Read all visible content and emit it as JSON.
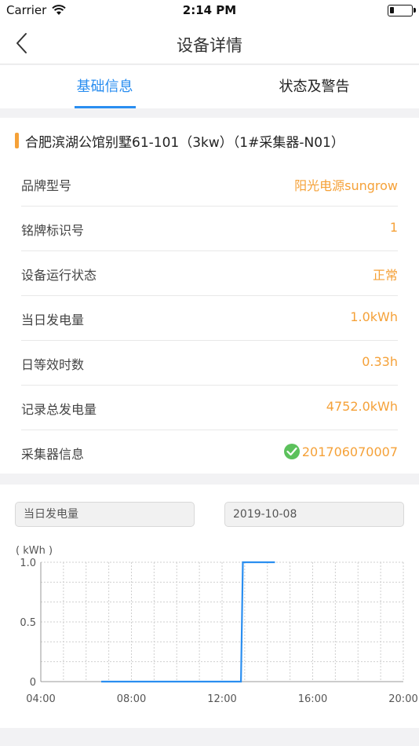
{
  "status_bar": {
    "carrier": "Carrier",
    "time": "2:14 PM",
    "battery_level": 0.2
  },
  "nav": {
    "title": "设备详情"
  },
  "tabs": [
    {
      "label": "基础信息",
      "active": true
    },
    {
      "label": "状态及警告",
      "active": false
    }
  ],
  "device": {
    "title": "合肥滨湖公馆别墅61-101（3kw）（1#采集器-N01）",
    "rows": [
      {
        "label": "品牌型号",
        "value": "阳光电源sungrow"
      },
      {
        "label": "铭牌标识号",
        "value": "1"
      },
      {
        "label": "设备运行状态",
        "value": "正常"
      },
      {
        "label": "当日发电量",
        "value": "1.0kWh"
      },
      {
        "label": "日等效时数",
        "value": "0.33h"
      },
      {
        "label": "记录总发电量",
        "value": "4752.0kWh"
      },
      {
        "label": "采集器信息",
        "value": "201706070007"
      }
    ]
  },
  "chart_controls": {
    "metric": "当日发电量",
    "date": "2019-10-08"
  },
  "colors": {
    "accent": "#2a8ef0",
    "value": "#f5a138",
    "ok": "#5cc15c"
  },
  "icons": {
    "back": "chevron-left-icon",
    "wifi": "wifi-icon",
    "battery": "battery-icon",
    "check": "check-circle-icon"
  },
  "chart_data": {
    "type": "line",
    "ylabel": "( kWh )",
    "ylim": [
      0,
      1.0
    ],
    "yticks": [
      {
        "value": 0,
        "label": "0"
      },
      {
        "value": 0.5,
        "label": "0.5"
      },
      {
        "value": 1.0,
        "label": "1.0"
      }
    ],
    "xlim": [
      "04:00",
      "20:00"
    ],
    "xticks": [
      "04:00",
      "08:00",
      "12:00",
      "16:00",
      "20:00"
    ],
    "grid": true,
    "series": [
      {
        "points": [
          {
            "x": "06:40",
            "y": 0
          },
          {
            "x": "12:50",
            "y": 0
          },
          {
            "x": "12:55",
            "y": 1.0
          },
          {
            "x": "14:20",
            "y": 1.0
          }
        ]
      }
    ]
  }
}
